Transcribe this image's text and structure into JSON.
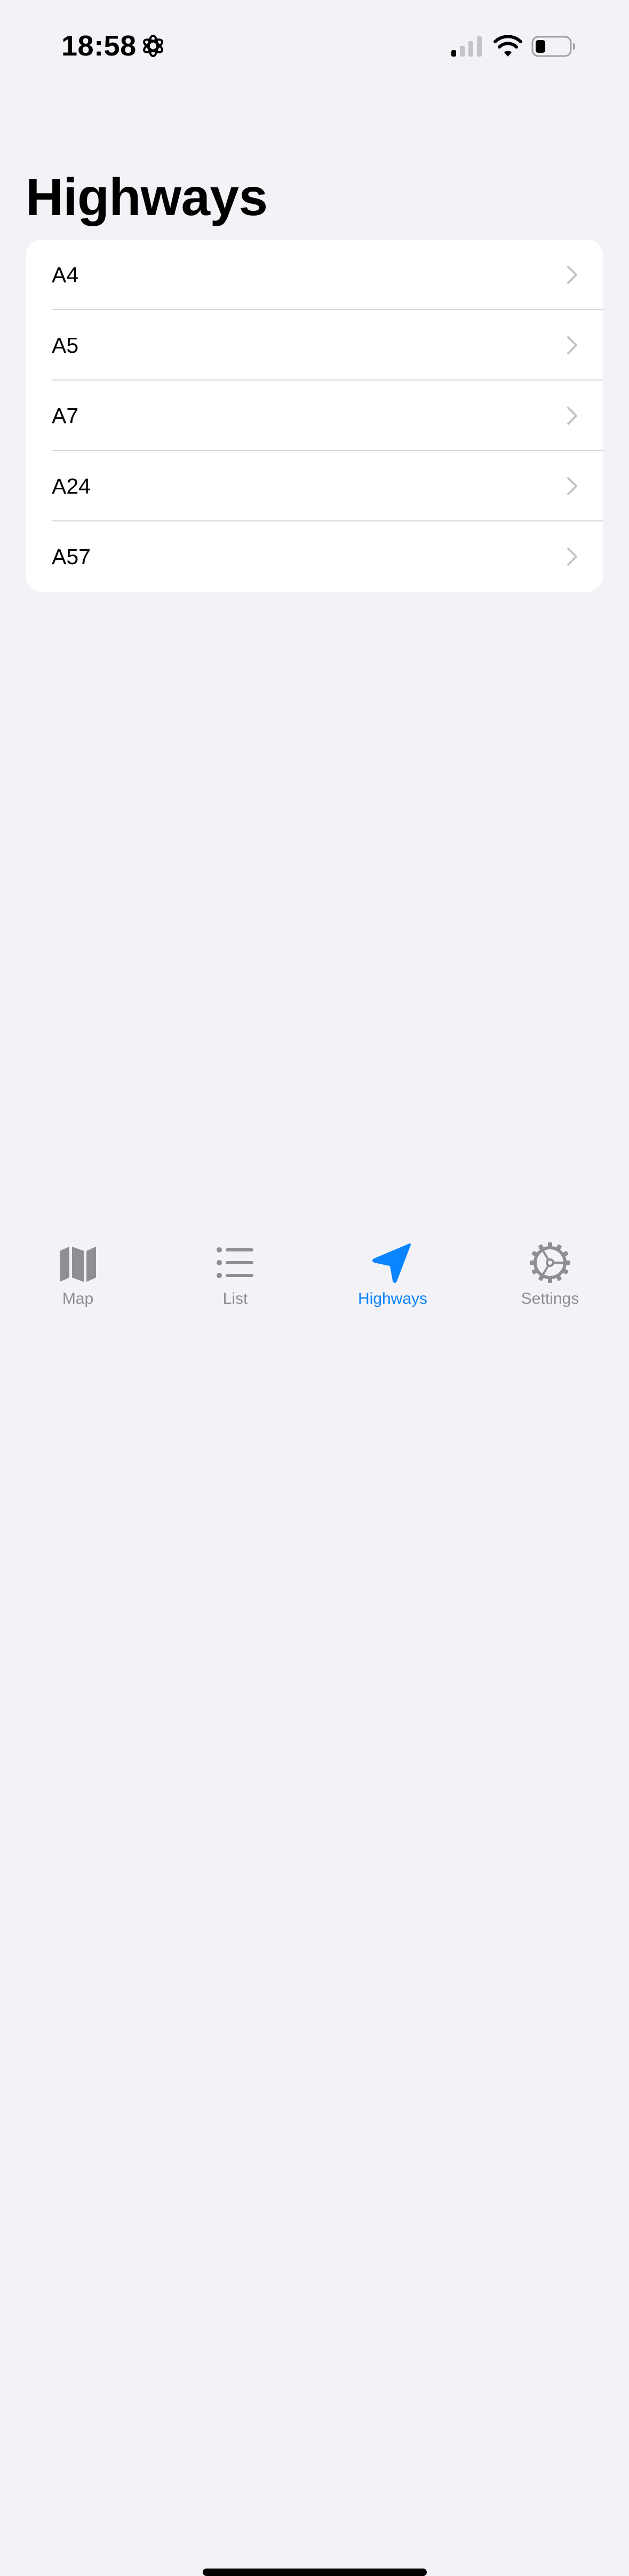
{
  "status_bar": {
    "time": "18:58",
    "focus_icon": "focus-flower-icon",
    "signal_icon": "cellular-signal-icon",
    "wifi_icon": "wifi-icon",
    "battery_icon": "battery-low-icon"
  },
  "page": {
    "title": "Highways"
  },
  "highways": [
    {
      "label": "A4"
    },
    {
      "label": "A5"
    },
    {
      "label": "A7"
    },
    {
      "label": "A24"
    },
    {
      "label": "A57"
    }
  ],
  "tab_bar": {
    "tabs": [
      {
        "label": "Map",
        "icon": "map-icon",
        "active": false
      },
      {
        "label": "List",
        "icon": "list-icon",
        "active": false
      },
      {
        "label": "Highways",
        "icon": "location-arrow-icon",
        "active": true
      },
      {
        "label": "Settings",
        "icon": "gear-icon",
        "active": false
      }
    ]
  },
  "colors": {
    "background": "#f2f2f7",
    "card": "#ffffff",
    "accent": "#0a84ff",
    "inactive": "#8e8e93",
    "chevron": "#c4c4c7"
  }
}
